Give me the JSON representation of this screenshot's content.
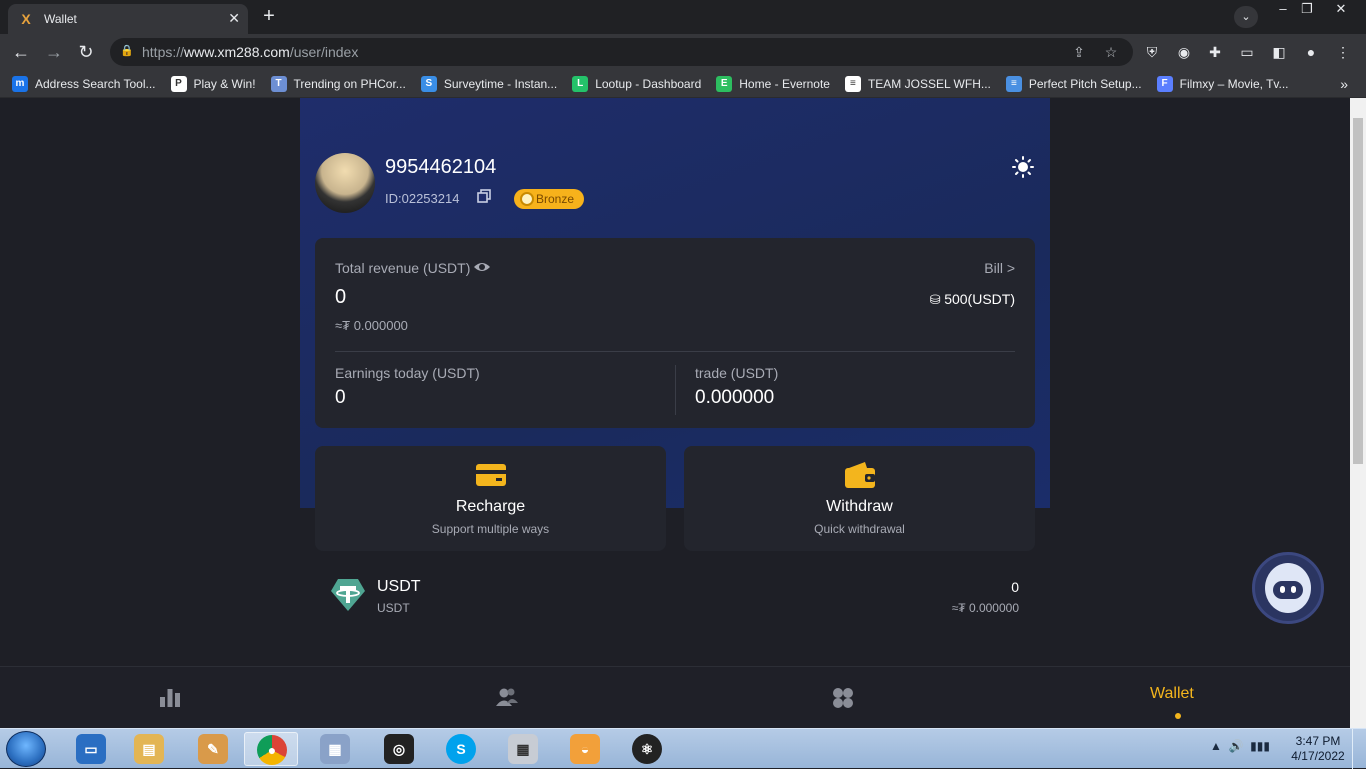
{
  "browser": {
    "tab_title": "Wallet",
    "tab_close": "✕",
    "new_tab": "+",
    "url_prefix": "https://",
    "url_host": "www.xm288.com",
    "url_path": "/user/index",
    "minimize": "–",
    "restore": "❐",
    "close": "✕"
  },
  "bookmarks": [
    {
      "label": "Address Search Tool...",
      "icon": "m",
      "color": "#1a73e8"
    },
    {
      "label": "Play & Win!",
      "icon": "P",
      "color": "#ffffff"
    },
    {
      "label": "Trending on PHCor...",
      "icon": "T",
      "color": "#6d8fd4"
    },
    {
      "label": "Surveytime - Instan...",
      "icon": "S",
      "color": "#3a8ee6"
    },
    {
      "label": "Lootup - Dashboard",
      "icon": "L",
      "color": "#24c26a"
    },
    {
      "label": "Home - Evernote",
      "icon": "E",
      "color": "#2dbe60"
    },
    {
      "label": "TEAM JOSSEL WFH...",
      "icon": "≡",
      "color": "#ffffff"
    },
    {
      "label": "Perfect Pitch Setup...",
      "icon": "≡",
      "color": "#4a90e2"
    },
    {
      "label": "Filmxy – Movie, Tv...",
      "icon": "F",
      "color": "#5b7fff"
    }
  ],
  "bookmarks_more": "»",
  "profile": {
    "username": "9954462104",
    "id_text": "ID:02253214",
    "level": "Bronze"
  },
  "revenue": {
    "label": "Total revenue (USDT)",
    "amount": "0",
    "fiat": "≈₮ 0.000000",
    "bill_link": "Bill >",
    "stake": "500(USDT)",
    "today_label": "Earnings today (USDT)",
    "today_value": "0",
    "trade_label": "trade (USDT)",
    "trade_value": "0.000000"
  },
  "actions": {
    "recharge_title": "Recharge",
    "recharge_sub": "Support multiple ways",
    "withdraw_title": "Withdraw",
    "withdraw_sub": "Quick withdrawal"
  },
  "asset": {
    "name": "USDT",
    "sub": "USDT",
    "balance": "0",
    "fiat": "≈₮ 0.000000"
  },
  "bottom_nav": {
    "active": "Wallet"
  },
  "colors": {
    "accent": "#f3b51d",
    "hero": "#1f2d6b",
    "card": "#23252d"
  },
  "taskbar": {
    "time": "3:47 PM",
    "date": "4/17/2022"
  }
}
